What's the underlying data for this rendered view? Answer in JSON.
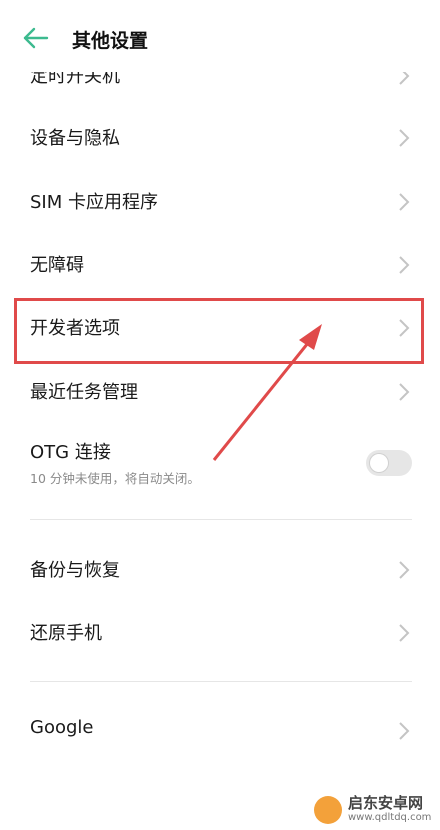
{
  "header": {
    "title": "其他设置",
    "back_icon": "arrow-left-icon",
    "accent": "#3cba8f"
  },
  "rows": {
    "partial": "定时开关机",
    "privacy": "设备与隐私",
    "sim": "SIM 卡应用程序",
    "accessibility": "无障碍",
    "developer": "开发者选项",
    "tasks": "最近任务管理",
    "otg": {
      "label": "OTG 连接",
      "subtitle": "10 分钟未使用，将自动关闭。",
      "enabled": false
    },
    "backup": "备份与恢复",
    "reset": "还原手机",
    "google": "Google"
  },
  "annotation": {
    "color": "#e04a4a"
  },
  "watermark": {
    "title": "启东安卓网",
    "url": "www.qdltdq.com"
  }
}
